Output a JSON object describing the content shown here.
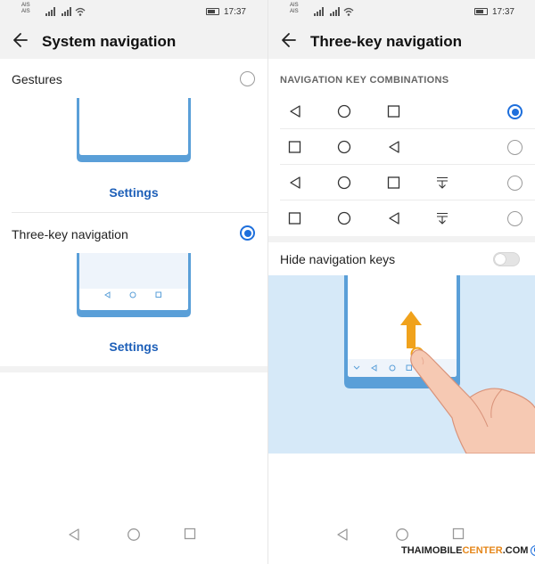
{
  "status_bar": {
    "carrier_1": "AIS",
    "carrier_2": "AIS",
    "time": "17:37"
  },
  "left_screen": {
    "title": "System navigation",
    "gestures": {
      "label": "Gestures",
      "selected": false,
      "settings_label": "Settings"
    },
    "three_key": {
      "label": "Three-key navigation",
      "selected": true,
      "settings_label": "Settings"
    }
  },
  "right_screen": {
    "title": "Three-key navigation",
    "section_header": "NAVIGATION KEY COMBINATIONS",
    "combinations": [
      {
        "keys": [
          "back-icon",
          "home-icon",
          "recents-icon"
        ],
        "selected": true
      },
      {
        "keys": [
          "recents-icon",
          "home-icon",
          "back-icon"
        ],
        "selected": false
      },
      {
        "keys": [
          "back-icon",
          "home-icon",
          "recents-icon",
          "notification-pulldown-icon"
        ],
        "selected": false
      },
      {
        "keys": [
          "recents-icon",
          "home-icon",
          "back-icon",
          "notification-pulldown-icon"
        ],
        "selected": false
      }
    ],
    "hide_keys": {
      "label": "Hide navigation keys",
      "enabled": false
    }
  },
  "colors": {
    "accent_blue": "#1e6fdc",
    "link_blue": "#1d5fb8",
    "phone_blue": "#5a9fd8",
    "illustration_bg": "#d6e9f8",
    "arrow_orange": "#f0a21c"
  },
  "watermark": {
    "text_part_1": "THAIMOBILE",
    "text_part_2": "CENTER",
    "text_part_3": ".COM",
    "symbol": "C"
  }
}
